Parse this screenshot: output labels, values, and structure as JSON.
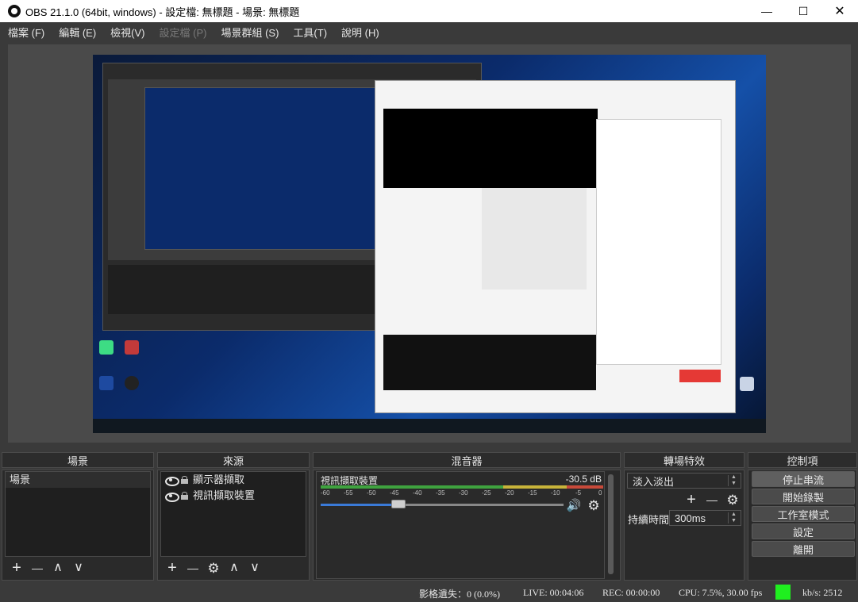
{
  "window": {
    "title": "OBS 21.1.0 (64bit, windows) - 設定檔: 無標題 - 場景: 無標題",
    "minimize_glyph": "—",
    "maximize_glyph": "☐",
    "close_glyph": "✕"
  },
  "menu": [
    {
      "label": "檔案 (F)",
      "enabled": true
    },
    {
      "label": "編輯 (E)",
      "enabled": true
    },
    {
      "label": "檢視(V)",
      "enabled": true
    },
    {
      "label": "設定檔 (P)",
      "enabled": false
    },
    {
      "label": "場景群組 (S)",
      "enabled": true
    },
    {
      "label": "工具(T)",
      "enabled": true
    },
    {
      "label": "說明 (H)",
      "enabled": true
    }
  ],
  "docks": {
    "scenes": {
      "header": "場景",
      "items": [
        "場景"
      ]
    },
    "sources": {
      "header": "來源",
      "items": [
        "顯示器擷取",
        "視訊擷取裝置"
      ]
    },
    "mixer": {
      "header": "混音器",
      "channel": "視訊擷取裝置",
      "db": "-30.5 dB",
      "ticks": [
        "-60",
        "-55",
        "-50",
        "-45",
        "-40",
        "-35",
        "-30",
        "-25",
        "-20",
        "-15",
        "-10",
        "-5",
        "0"
      ],
      "volume_fraction": 0.32
    },
    "transitions": {
      "header": "轉場特效",
      "selected": "淡入淡出",
      "duration_label": "持續時間",
      "duration_value": "300ms"
    },
    "controls": {
      "header": "控制項",
      "buttons": [
        "停止串流",
        "開始錄製",
        "工作室模式",
        "設定",
        "離開"
      ]
    }
  },
  "toolbar_glyphs": {
    "add": "+",
    "remove": "—",
    "up": "∧",
    "down": "∨",
    "gear": "⚙",
    "speaker": "🔊"
  },
  "status": {
    "dropped": "影格遺失：0 (0.0%)",
    "live": "LIVE: 00:04:06",
    "rec": "REC: 00:00:00",
    "cpu": "CPU: 7.5%, 30.00 fps",
    "bitrate": "kb/s: 2512"
  },
  "colors": {
    "accent_slider": "#3a7ad8",
    "live_indicator": "#1fef1f",
    "meter_green": "#3fa33f",
    "meter_yellow": "#c8b43a",
    "meter_red": "#c84a3a"
  }
}
